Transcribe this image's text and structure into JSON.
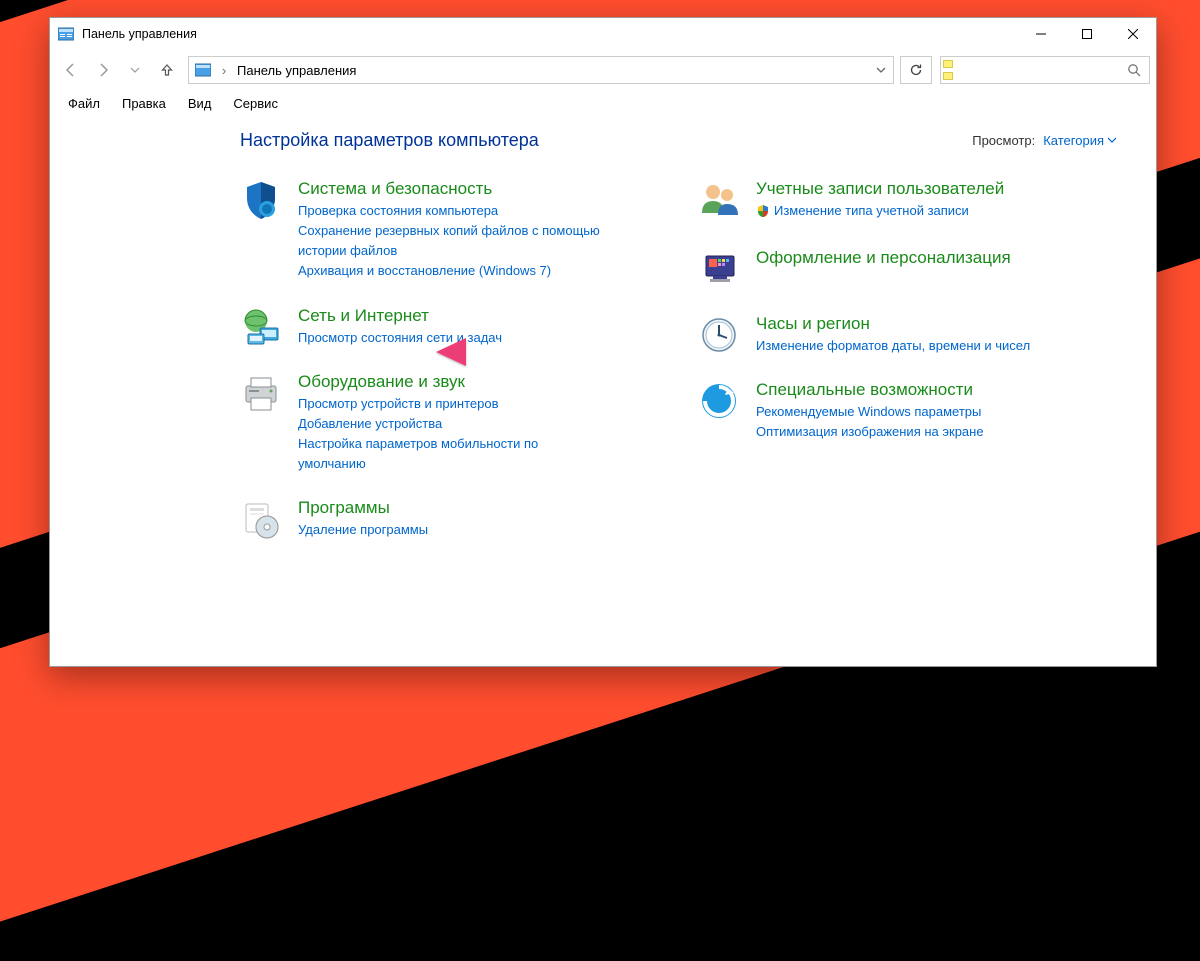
{
  "window": {
    "title": "Панель управления"
  },
  "breadcrumb": {
    "root": "Панель управления"
  },
  "menubar": [
    "Файл",
    "Правка",
    "Вид",
    "Сервис"
  ],
  "heading": "Настройка параметров компьютера",
  "view": {
    "label": "Просмотр:",
    "value": "Категория"
  },
  "left": [
    {
      "title": "Система и безопасность",
      "subs": [
        "Проверка состояния компьютера",
        "Сохранение резервных копий файлов с помощью истории файлов",
        "Архивация и восстановление (Windows 7)"
      ]
    },
    {
      "title": "Сеть и Интернет",
      "subs": [
        "Просмотр состояния сети и задач"
      ]
    },
    {
      "title": "Оборудование и звук",
      "subs": [
        "Просмотр устройств и принтеров",
        "Добавление устройства",
        "Настройка параметров мобильности по умолчанию"
      ]
    },
    {
      "title": "Программы",
      "subs": [
        "Удаление программы"
      ]
    }
  ],
  "right": [
    {
      "title": "Учетные записи пользователей",
      "subs": [
        "Изменение типа учетной записи"
      ],
      "shield": true
    },
    {
      "title": "Оформление и персонализация",
      "subs": []
    },
    {
      "title": "Часы и регион",
      "subs": [
        "Изменение форматов даты, времени и чисел"
      ]
    },
    {
      "title": "Специальные возможности",
      "subs": [
        "Рекомендуемые Windows параметры",
        "Оптимизация изображения на экране"
      ]
    }
  ]
}
